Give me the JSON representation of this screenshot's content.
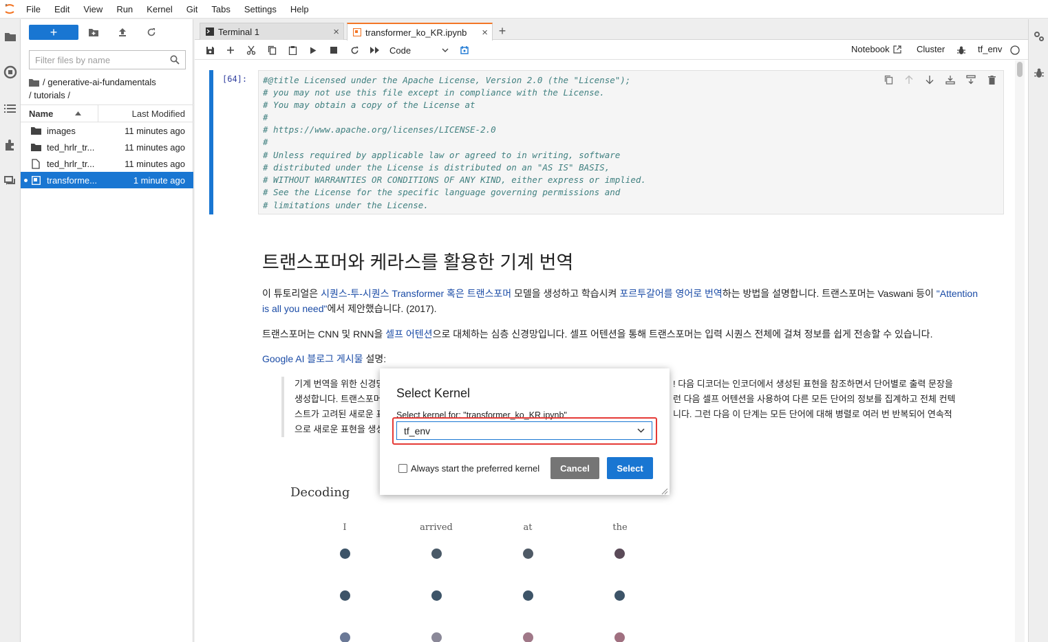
{
  "menubar": {
    "items": [
      "File",
      "Edit",
      "View",
      "Run",
      "Kernel",
      "Git",
      "Tabs",
      "Settings",
      "Help"
    ]
  },
  "filebrowser": {
    "new_label": "+",
    "filter_placeholder": "Filter files by name",
    "breadcrumb_1": "/ generative-ai-fundamentals",
    "breadcrumb_2": "/ tutorials /",
    "col_name": "Name",
    "col_modified": "Last Modified",
    "rows": [
      {
        "name": "images",
        "modified": "11 minutes ago",
        "icon": "folder-icon"
      },
      {
        "name": "ted_hrlr_tr...",
        "modified": "11 minutes ago",
        "icon": "folder-icon"
      },
      {
        "name": "ted_hrlr_tr...",
        "modified": "11 minutes ago",
        "icon": "file-icon"
      },
      {
        "name": "transforme...",
        "modified": "1 minute ago",
        "icon": "notebook-icon"
      }
    ]
  },
  "tabs": {
    "terminal": "Terminal 1",
    "notebook": "transformer_ko_KR.ipynb"
  },
  "toolbar": {
    "cell_type": "Code",
    "notebook_label": "Notebook",
    "cluster_label": "Cluster",
    "kernel_name": "tf_env"
  },
  "code_cell": {
    "prompt": "[64]:",
    "lines": [
      "#@title Licensed under the Apache License, Version 2.0 (the \"License\");",
      "# you may not use this file except in compliance with the License.",
      "# You may obtain a copy of the License at",
      "#",
      "# https://www.apache.org/licenses/LICENSE-2.0",
      "#",
      "# Unless required by applicable law or agreed to in writing, software",
      "# distributed under the License is distributed on an \"AS IS\" BASIS,",
      "# WITHOUT WARRANTIES OR CONDITIONS OF ANY KIND, either express or implied.",
      "# See the License for the specific language governing permissions and",
      "# limitations under the License."
    ]
  },
  "markdown": {
    "h1": "트랜스포머와 케라스를 활용한 기계 번역",
    "p1_a": "이 튜토리얼은 ",
    "p1_link1": "시퀀스-투-시퀀스 Transformer 혹은 트랜스포머",
    "p1_b": " 모델을 생성하고 학습시켜 ",
    "p1_link2": "포르투갈어를 영어로 번역",
    "p1_c": "하는 방법을 설명합니다. 트랜스포머는 Vaswani 등이 ",
    "p1_link3": "\"Attention is all you need\"",
    "p1_d": "에서 제안했습니다. (2017).",
    "p2_a": "트랜스포머는 CNN 및 RNN을 ",
    "p2_link": "셀프 어텐션",
    "p2_b": "으로 대체하는 심층 신경망입니다. 셀프 어텐션을 통해 트랜스포머는 입력 시퀀스 전체에 걸쳐 정보를 쉽게 전송할 수 있습니다.",
    "p3_link": "Google AI 블로그 게시물",
    "p3_b": " 설명:",
    "quote_l1a": "기계 번역을 위한 신경망",
    "quote_l1b": "! 다음 디코더는 인코더에서 생성된 표현을 참조하면서 단어별로 출력 문장을",
    "quote_l2a": "생성합니다. 트랜스포머",
    "quote_l2b": "런 다음 셀프 어텐션을 사용하여 다른 모든 단어의 정보를 집계하고 전체 컨텍",
    "quote_l3a": "스트가 고려된 새로운 표",
    "quote_l3b": "니다. 그런 다음 이 단계는 모든 단어에 대해 병렬로 여러 번 반복되어 연속적",
    "quote_l4a": "으로 새로운 표현을 생성"
  },
  "figure": {
    "title": "Decoding",
    "words": [
      "I",
      "arrived",
      "at",
      "the"
    ]
  },
  "dialog": {
    "title": "Select Kernel",
    "subtitle": "Select kernel for: \"transformer_ko_KR.ipynb\"",
    "selected_kernel": "tf_env",
    "checkbox_label": "Always start the preferred kernel",
    "cancel_label": "Cancel",
    "select_label": "Select"
  },
  "colors": {
    "accent": "#1976d2",
    "tab_active": "#f37626",
    "highlight": "#e53935",
    "link": "#1a4ba6"
  }
}
